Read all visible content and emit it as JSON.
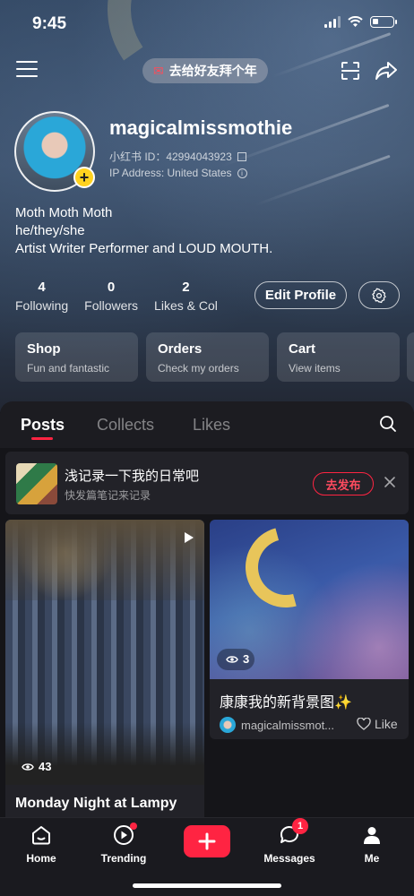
{
  "status_bar": {
    "time": "9:45"
  },
  "header": {
    "greeting": "去给好友拜个年"
  },
  "profile": {
    "username": "magicalmissmothie",
    "user_id": "小红书 ID：42994043923",
    "ip_address": "IP Address: United States",
    "bio": [
      "Moth Moth Moth",
      "he/they/she",
      "Artist Writer Performer and LOUD MOUTH."
    ],
    "stats": [
      {
        "num": "4",
        "label": "Following"
      },
      {
        "num": "0",
        "label": "Followers"
      },
      {
        "num": "2",
        "label": "Likes & Col"
      }
    ],
    "edit_label": "Edit Profile"
  },
  "cards": [
    {
      "title": "Shop",
      "sub": "Fun and fantastic"
    },
    {
      "title": "Orders",
      "sub": "Check my orders"
    },
    {
      "title": "Cart",
      "sub": "View items"
    }
  ],
  "tabs": [
    {
      "label": "Posts",
      "active": true
    },
    {
      "label": "Collects",
      "active": false
    },
    {
      "label": "Likes",
      "active": false
    }
  ],
  "draft": {
    "title": "浅记录一下我的日常吧",
    "sub": "快发篇笔记来记录",
    "button": "去发布"
  },
  "notes": [
    {
      "views": "43",
      "title": "Monday Night at Lampy"
    },
    {
      "views": "3",
      "title": "康康我的新背景图✨",
      "author": "magicalmissmot...",
      "like_label": "Like"
    }
  ],
  "bottom_nav": [
    {
      "label": "Home"
    },
    {
      "label": "Trending"
    },
    {
      "label": "Messages",
      "badge": "1"
    },
    {
      "label": "Me"
    }
  ],
  "colors": {
    "accent": "#ff2442",
    "avatar_badge": "#ffd21f"
  }
}
